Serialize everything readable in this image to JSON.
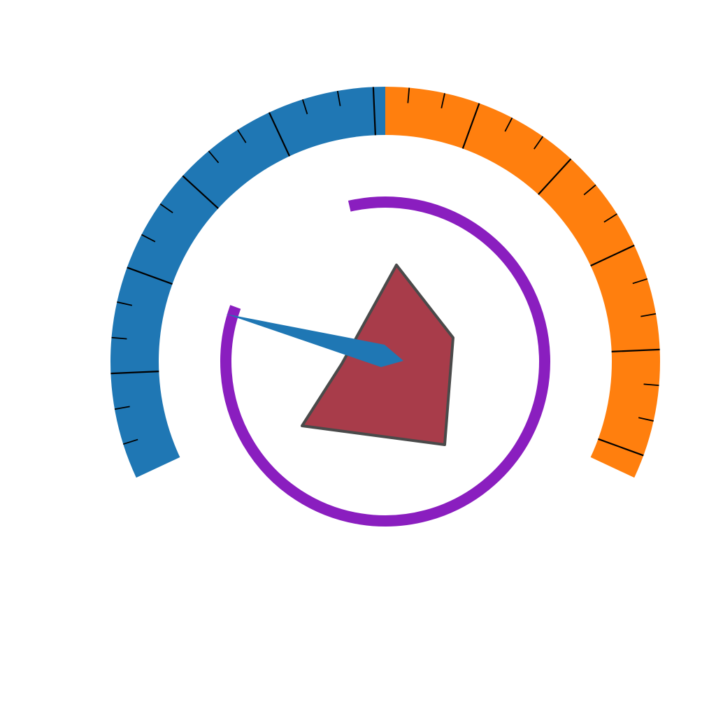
{
  "gauge": {
    "min_angle_deg": 205,
    "max_angle_deg": -25,
    "needle_angle_deg": 164,
    "ring_gap_from_deg": 160,
    "ring_gap_to_deg": 103,
    "major_tick_step_deg": 22.5,
    "minor_tick_step_deg": 7.5,
    "colors": {
      "left_band": "#1f77b4",
      "right_band": "#ff7f0e",
      "ticks": "#000000",
      "ring": "#8a1ebf",
      "needle": "#1f77b4",
      "polygon_fill": "#a83c4a",
      "polygon_stroke": "#4a4a4a"
    }
  }
}
